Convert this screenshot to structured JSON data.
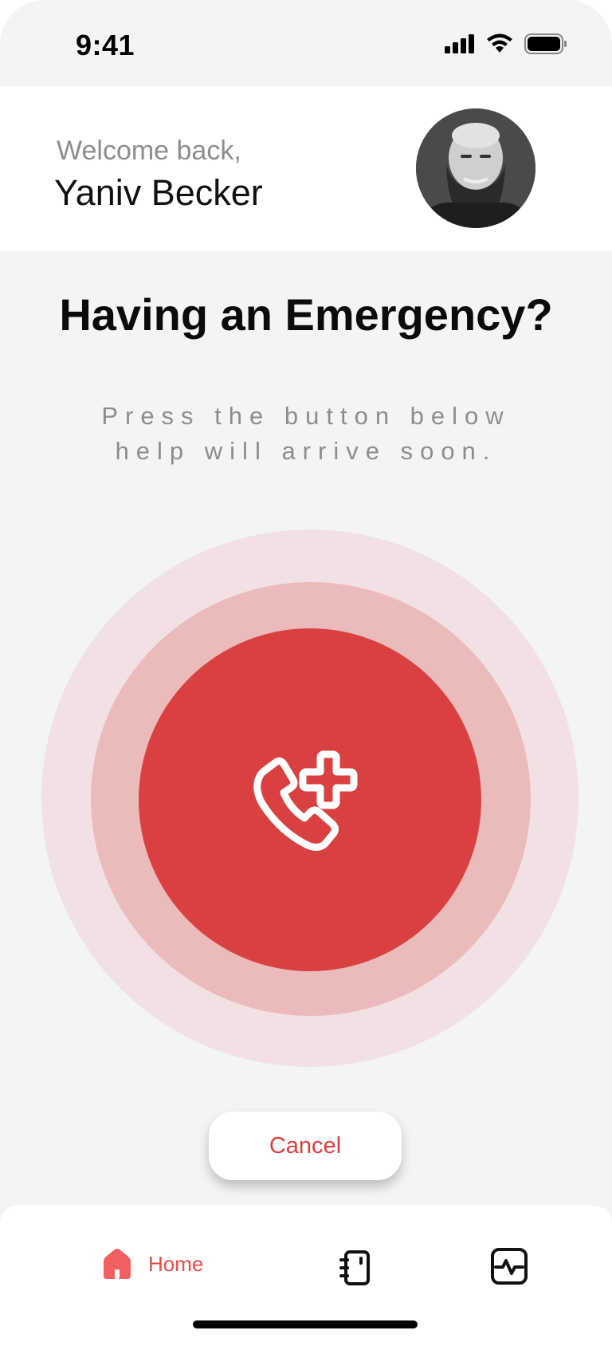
{
  "status_bar": {
    "time": "9:41",
    "icons": [
      "cellular-signal-icon",
      "wifi-icon",
      "battery-icon"
    ]
  },
  "header": {
    "welcome_text": "Welcome back,",
    "user_name": "Yaniv Becker",
    "avatar_icon": "user-avatar-photo"
  },
  "main": {
    "title": "Having an Emergency?",
    "subtitle_line1": "Press the button below",
    "subtitle_line2": "help will arrive soon.",
    "sos_icon": "emergency-call-icon",
    "cancel_label": "Cancel"
  },
  "bottom_nav": {
    "items": [
      {
        "label": "Home",
        "icon": "home-icon",
        "active": true
      },
      {
        "label": "",
        "icon": "contacts-book-icon",
        "active": false
      },
      {
        "label": "",
        "icon": "health-monitor-icon",
        "active": false
      }
    ]
  },
  "colors": {
    "accent": "#d94141",
    "ring_outer": "#f2e1e4",
    "ring_middle": "#ebbbbc",
    "background": "#f3f4f6",
    "nav_active": "#e84a4a"
  }
}
